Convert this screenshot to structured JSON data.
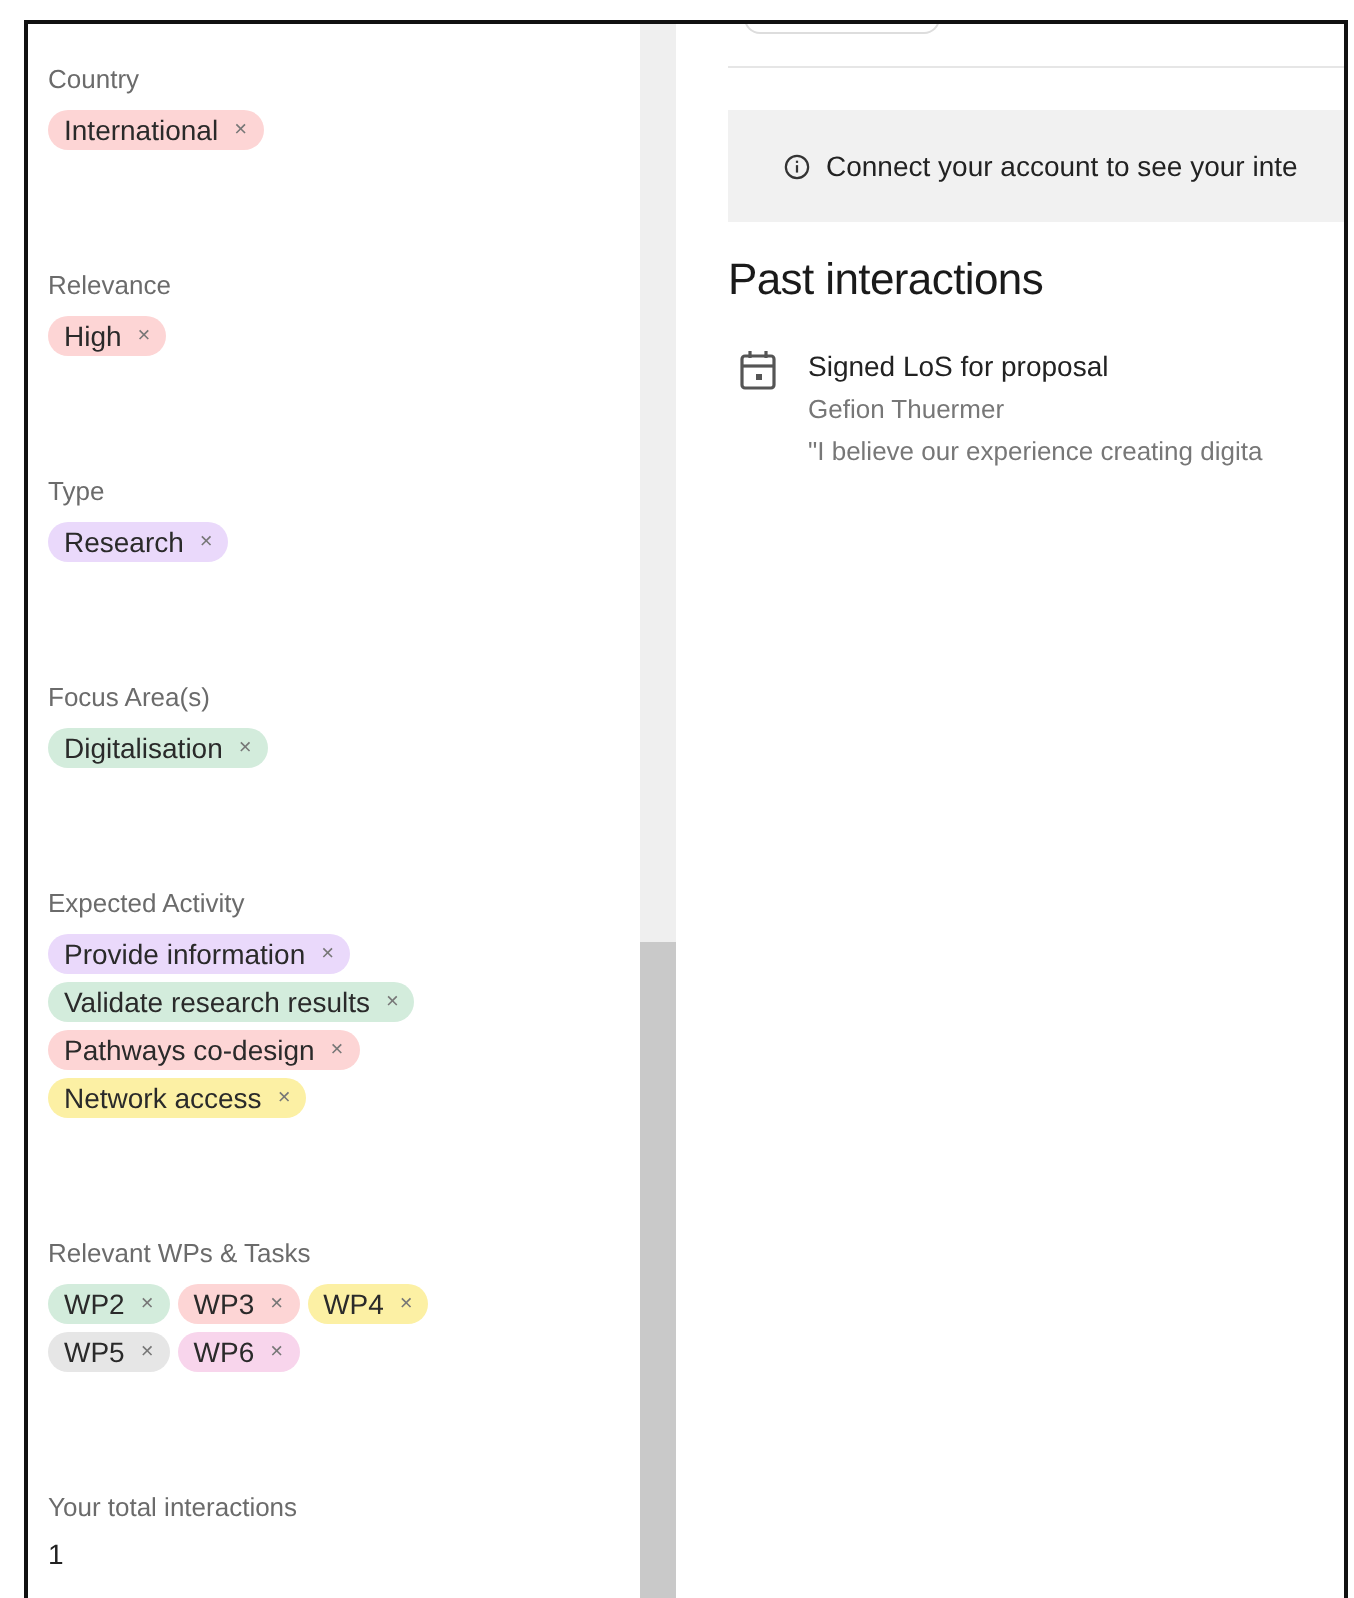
{
  "filters": [
    {
      "label": "Country",
      "tags": [
        {
          "text": "International",
          "color": "#fdd5d5"
        }
      ]
    },
    {
      "label": "Relevance",
      "tags": [
        {
          "text": "High",
          "color": "#fdd5d5"
        }
      ]
    },
    {
      "label": "Type",
      "tags": [
        {
          "text": "Research",
          "color": "#ead9fb"
        }
      ]
    },
    {
      "label": "Focus Area(s)",
      "tags": [
        {
          "text": "Digitalisation",
          "color": "#d3ecdc"
        }
      ]
    },
    {
      "label": "Expected Activity",
      "tags": [
        {
          "text": "Provide information",
          "color": "#ead9fb"
        },
        {
          "text": "Validate research results",
          "color": "#d3ecdc"
        },
        {
          "text": "Pathways co-design",
          "color": "#fdd5d5"
        },
        {
          "text": "Network access",
          "color": "#fcf0a4"
        }
      ]
    },
    {
      "label": "Relevant WPs & Tasks",
      "tags": [
        {
          "text": "WP2",
          "color": "#d3ecdc"
        },
        {
          "text": "WP3",
          "color": "#fdd5d5"
        },
        {
          "text": "WP4",
          "color": "#fcf0a4"
        },
        {
          "text": "WP5",
          "color": "#e6e6e6"
        },
        {
          "text": "WP6",
          "color": "#f8d5ec"
        }
      ]
    }
  ],
  "remove_symbol": "×",
  "total_interactions": {
    "label": "Your total interactions",
    "value": "1"
  },
  "notice": "Connect your account to see your inte",
  "past_interactions": {
    "title": "Past interactions",
    "items": [
      {
        "title": "Signed LoS for proposal",
        "author": "Gefion Thuermer",
        "quote": "\"I believe our experience creating digita"
      }
    ]
  }
}
